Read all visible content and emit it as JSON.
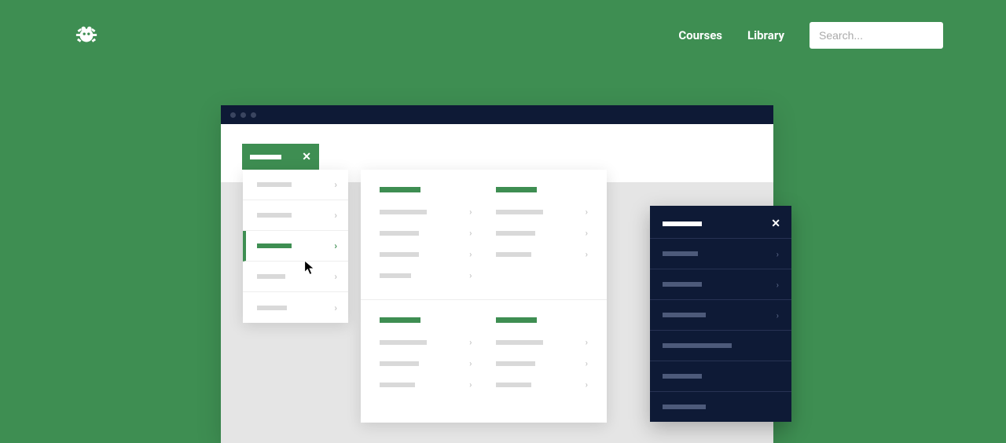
{
  "header": {
    "nav": {
      "courses": "Courses",
      "library": "Library"
    },
    "search": {
      "placeholder": "Search..."
    }
  },
  "colors": {
    "brand": "#3e8e52",
    "dark": "#0e1a36"
  }
}
